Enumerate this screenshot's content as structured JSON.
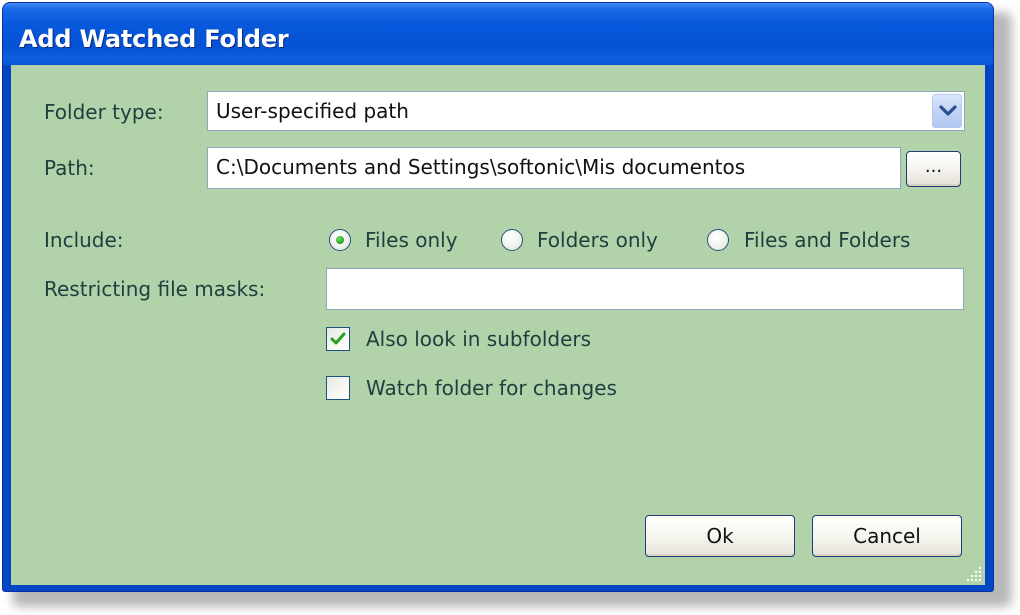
{
  "window": {
    "title": "Add Watched Folder"
  },
  "form": {
    "folder_type": {
      "label": "Folder type:",
      "selected": "User-specified path"
    },
    "path": {
      "label": "Path:",
      "value": "C:\\Documents and Settings\\softonic\\Mis documentos",
      "browse_label": "..."
    },
    "include": {
      "label": "Include:",
      "options": [
        {
          "label": "Files only",
          "selected": true
        },
        {
          "label": "Folders only",
          "selected": false
        },
        {
          "label": "Files and Folders",
          "selected": false
        }
      ]
    },
    "masks": {
      "label": "Restricting file masks:",
      "value": ""
    },
    "subfolders": {
      "label": "Also look in subfolders",
      "checked": true
    },
    "watch": {
      "label": "Watch folder for changes",
      "checked": false
    }
  },
  "buttons": {
    "ok": "Ok",
    "cancel": "Cancel"
  },
  "colors": {
    "client_bg": "#b2d3a9",
    "titlebar": "#0452d3",
    "label_text": "#1e3f3f",
    "radio_dot": "#2fa52f"
  }
}
